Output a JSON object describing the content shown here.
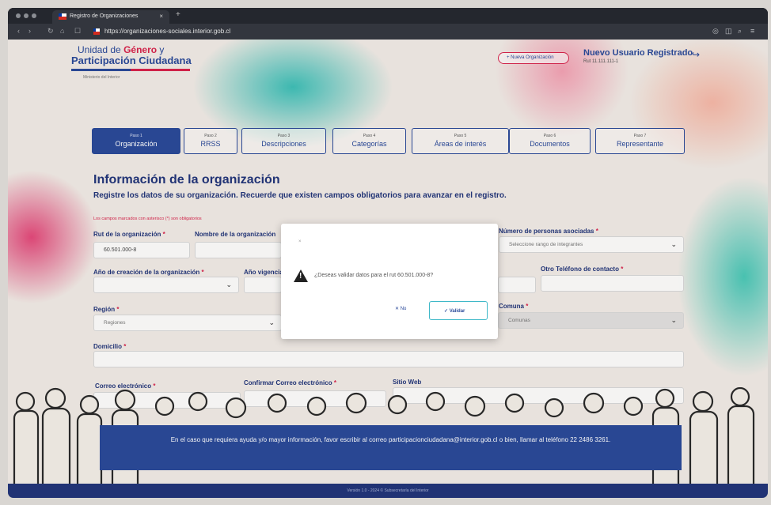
{
  "browser": {
    "tab_title": "Registro de Organizaciones",
    "tab_close": "×",
    "new_tab": "+",
    "url": "https://organizaciones-sociales.interior.gob.cl"
  },
  "header": {
    "logo_prefix": "Unidad de",
    "logo_highlight": "Género",
    "logo_suffix": "y",
    "logo_line2": "Participación Ciudadana",
    "logo_sub": "Ministerio del Interior",
    "new_org_button": "+ Nueva Organización",
    "user_name": "Nuevo Usuario Registrado",
    "user_rut": "Rut 11.111.111-1",
    "logout_icon": "logout-icon"
  },
  "steps": [
    {
      "num": "Paso 1",
      "label": "Organización"
    },
    {
      "num": "Paso 2",
      "label": "RRSS"
    },
    {
      "num": "Paso 3",
      "label": "Descripciones"
    },
    {
      "num": "Paso 4",
      "label": "Categorías"
    },
    {
      "num": "Paso 5",
      "label": "Áreas de interés"
    },
    {
      "num": "Paso 6",
      "label": "Documentos"
    },
    {
      "num": "Paso 7",
      "label": "Representante"
    }
  ],
  "form": {
    "title": "Información de la organización",
    "subtitle": "Registre los datos de su organización. Recuerde que existen campos obligatorios para avanzar en el registro.",
    "required_note": "Los campos marcados con asterisco (*) son obligatorios",
    "rut_label": "Rut de la organización",
    "rut_value": "60.501.000-8",
    "name_label": "Nombre de la organización",
    "personas_label": "Número de personas asociadas",
    "personas_placeholder": "Seleccione rango de integrantes",
    "anio_label": "Año de creación de la organización",
    "vigencia_label": "Año vigencia",
    "otro_tel_label": "Otro Teléfono de contacto",
    "region_label": "Región",
    "region_placeholder": "Regiones",
    "comuna_label": "Comuna",
    "comuna_placeholder": "Comunas",
    "domicilio_label": "Domicilio",
    "correo_label": "Correo electrónico",
    "confirmar_label": "Confirmar Correo electrónico",
    "sitio_label": "Sitio Web",
    "asterisk": "*"
  },
  "modal": {
    "close_label": "×",
    "message": "¿Deseas validar datos para el rut 60.501.000-8?",
    "no_label": "✕ No",
    "yes_label": "✓ Validar"
  },
  "help_text": "En el caso que requiera ayuda y/o mayor información, favor escribir al correo participacionciudadana@interior.gob.cl o bien, llamar al teléfono 22 2486 3261.",
  "footer": "Versión 1.0 - 2024 © Subsecretaría del Interior"
}
